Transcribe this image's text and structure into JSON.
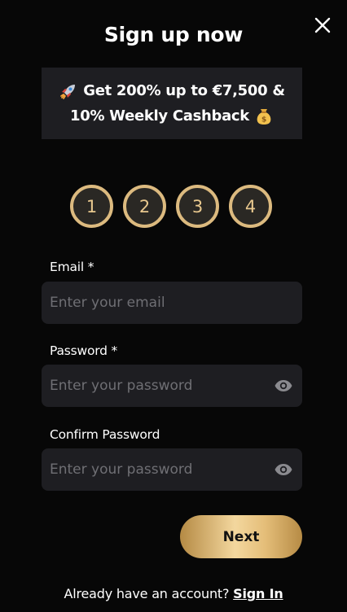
{
  "modal": {
    "title": "Sign up now",
    "close_icon": "close-icon"
  },
  "promo": {
    "line1_icon": "rocket-icon",
    "line1_text": "Get 200% up to €7,500 &",
    "line2_text": "10% Weekly Cashback",
    "line2_icon": "money-bag-icon"
  },
  "steps": [
    "1",
    "2",
    "3",
    "4"
  ],
  "form": {
    "email": {
      "label": "Email *",
      "placeholder": "Enter your email",
      "value": ""
    },
    "password": {
      "label": "Password *",
      "placeholder": "Enter your password",
      "value": "",
      "toggle_icon": "eye-icon"
    },
    "confirm_password": {
      "label": "Confirm Password",
      "placeholder": "Enter your password",
      "value": "",
      "toggle_icon": "eye-icon"
    },
    "next_label": "Next"
  },
  "footer": {
    "prompt": "Already have an account?",
    "signin_label": "Sign In"
  },
  "colors": {
    "background": "#070707",
    "panel": "#1e1e22",
    "gold": "#dcba7f",
    "step_fill": "#2a2824",
    "placeholder": "#6f6f74"
  }
}
